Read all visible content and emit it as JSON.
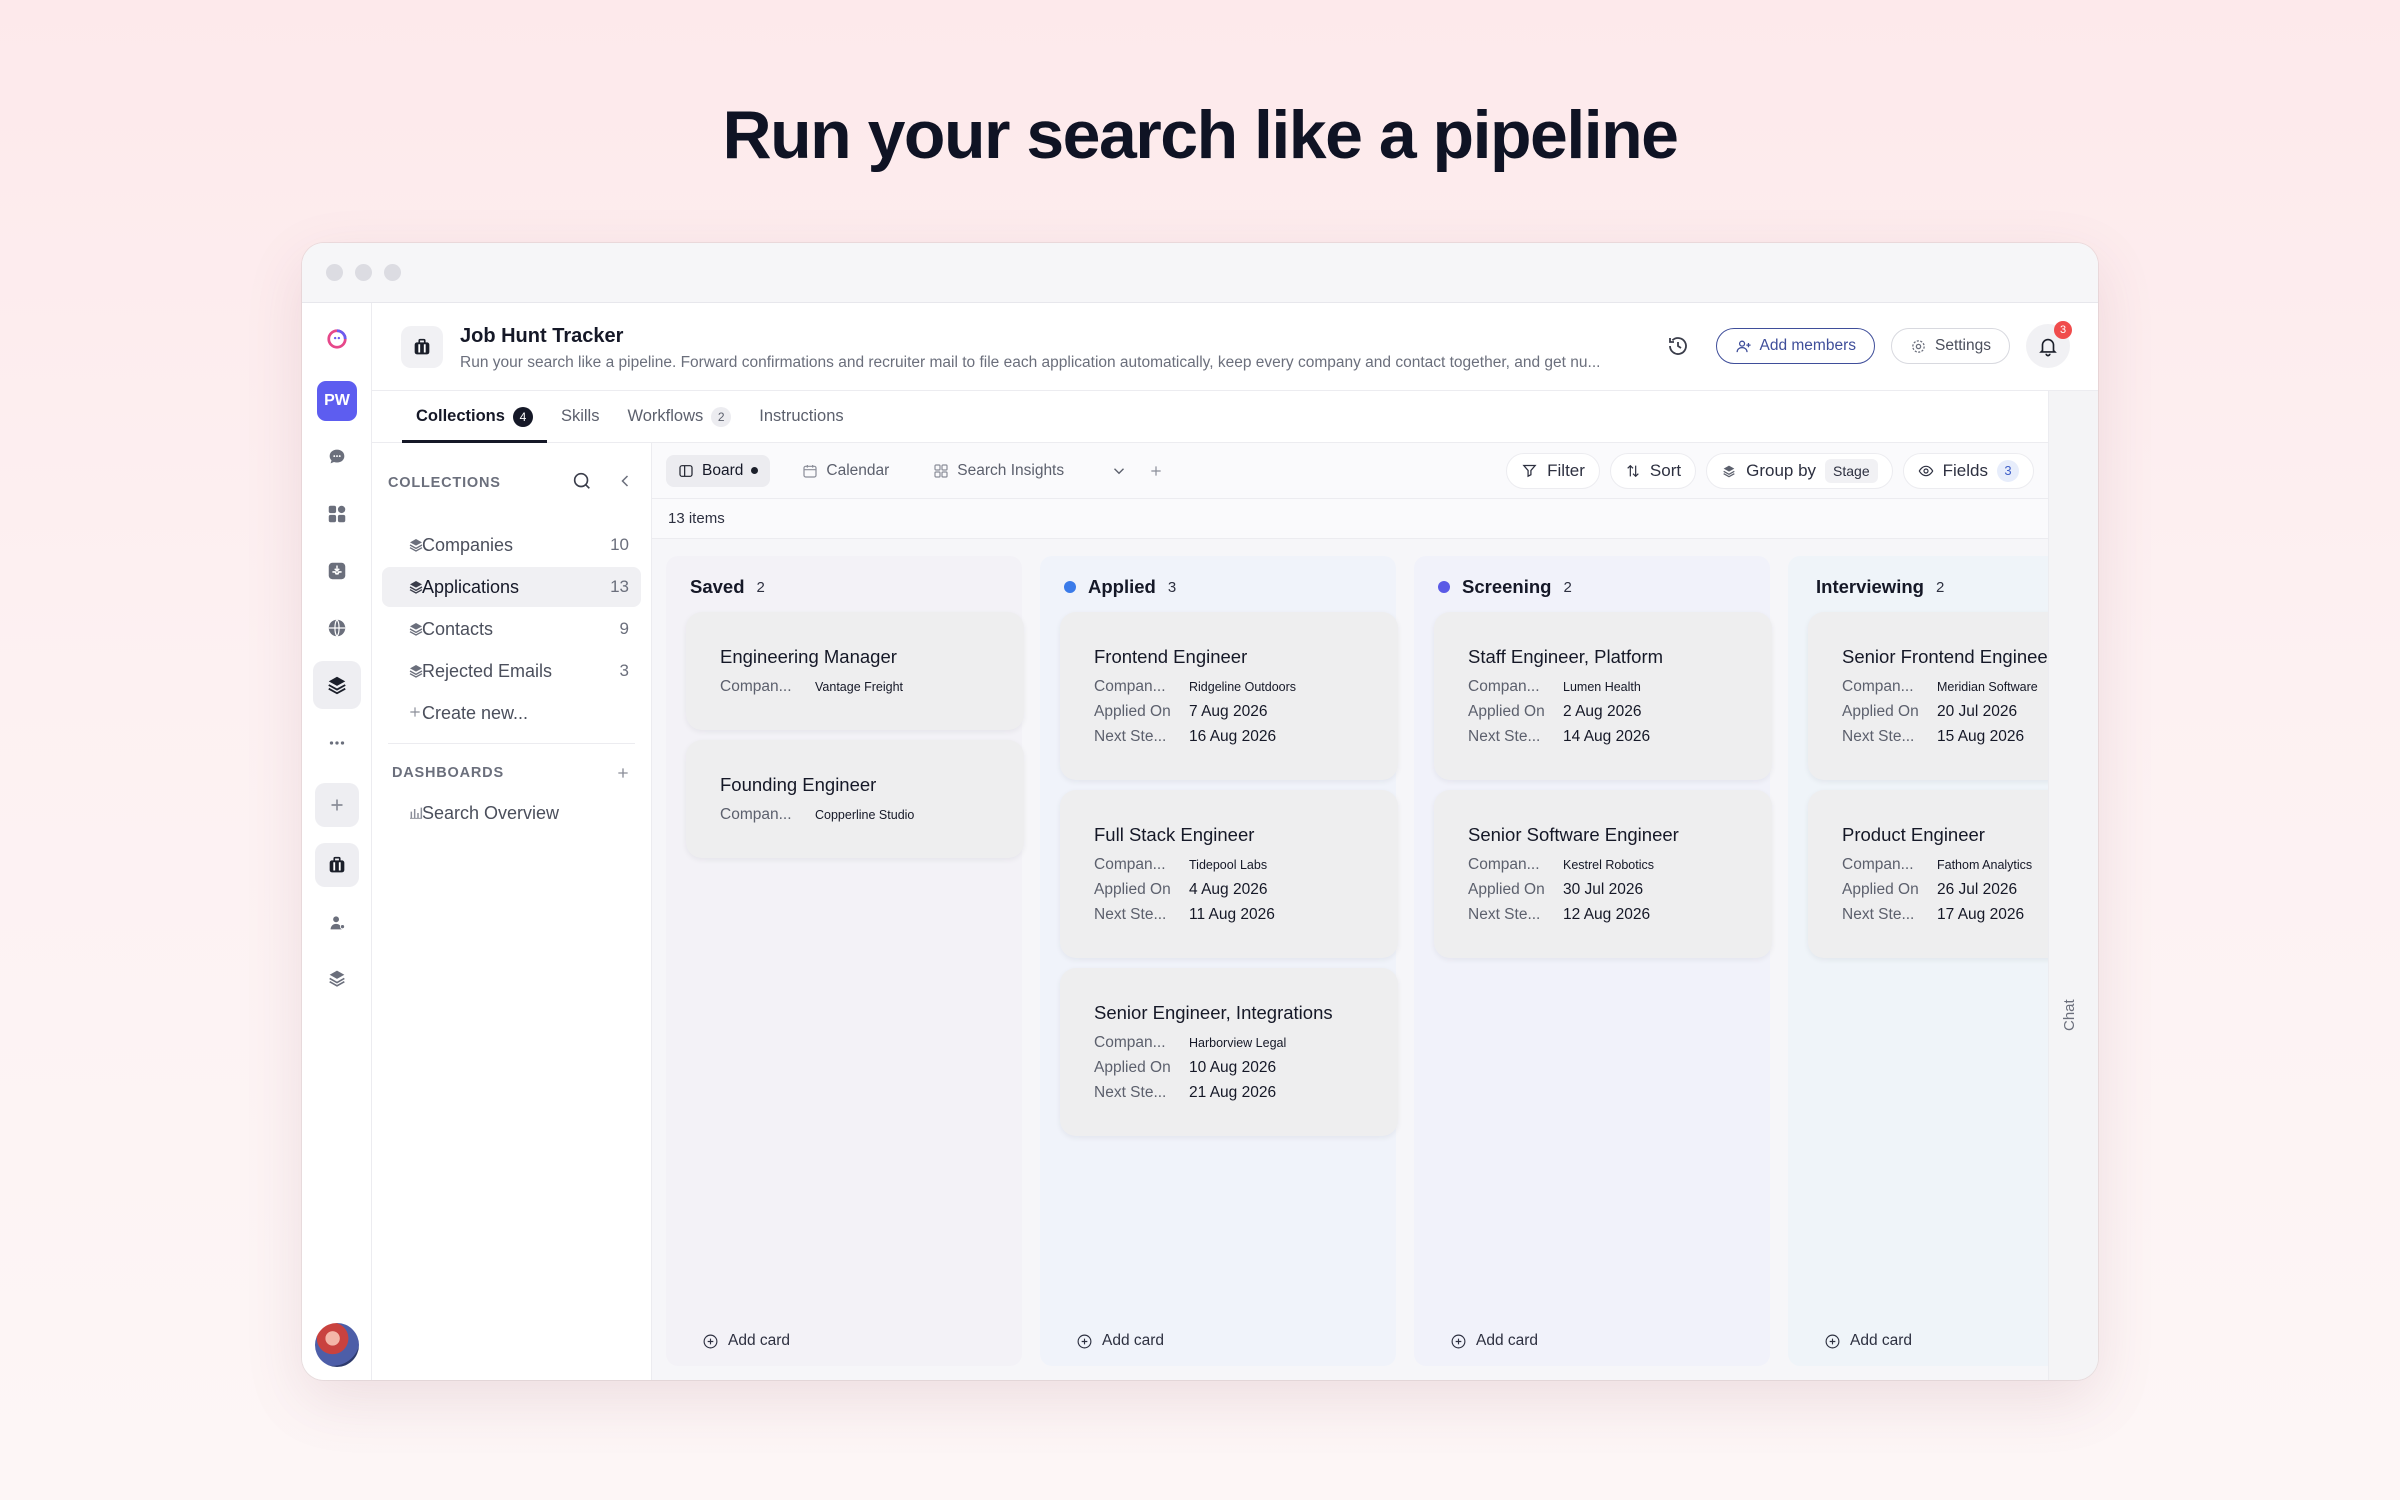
{
  "hero": {
    "title": "Run your search like a pipeline"
  },
  "rail": {
    "workspace_initials": "PW"
  },
  "header": {
    "title": "Job Hunt Tracker",
    "description": "Run your search like a pipeline. Forward confirmations and recruiter mail to file each application automatically, keep every company and contact together, and get nu...",
    "add_members_label": "Add members",
    "settings_label": "Settings",
    "notification_count": "3"
  },
  "tabs": [
    {
      "label": "Collections",
      "count": "4"
    },
    {
      "label": "Skills",
      "count": ""
    },
    {
      "label": "Workflows",
      "count": "2"
    },
    {
      "label": "Instructions",
      "count": ""
    }
  ],
  "chat_label": "Chat",
  "sidebar": {
    "collections_heading": "COLLECTIONS",
    "collections": [
      {
        "label": "Companies",
        "count": "10"
      },
      {
        "label": "Applications",
        "count": "13"
      },
      {
        "label": "Contacts",
        "count": "9"
      },
      {
        "label": "Rejected Emails",
        "count": "3"
      }
    ],
    "create_new": "Create new...",
    "dashboards_heading": "DASHBOARDS",
    "dashboards": [
      {
        "label": "Search Overview"
      }
    ]
  },
  "toolbar": {
    "views": [
      {
        "label": "Board"
      },
      {
        "label": "Calendar"
      },
      {
        "label": "Search Insights"
      }
    ],
    "filter_label": "Filter",
    "sort_label": "Sort",
    "group_by_label": "Group by",
    "group_by_value": "Stage",
    "fields_label": "Fields",
    "fields_count": "3"
  },
  "items_count": "13 items",
  "add_card_label": "Add card",
  "field_labels": {
    "company": "Compan...",
    "applied_on": "Applied On",
    "next_step": "Next Ste..."
  },
  "columns": [
    {
      "name": "Saved",
      "count": "2",
      "dot_color": "",
      "cards": [
        {
          "title": "Engineering Manager",
          "company": "Vantage Freight",
          "applied_on": "",
          "next_step": ""
        },
        {
          "title": "Founding Engineer",
          "company": "Copperline Studio",
          "applied_on": "",
          "next_step": ""
        }
      ]
    },
    {
      "name": "Applied",
      "count": "3",
      "dot_color": "#3b7be9",
      "cards": [
        {
          "title": "Frontend Engineer",
          "company": "Ridgeline Outdoors",
          "applied_on": "7 Aug 2026",
          "next_step": "16 Aug 2026"
        },
        {
          "title": "Full Stack Engineer",
          "company": "Tidepool Labs",
          "applied_on": "4 Aug 2026",
          "next_step": "11 Aug 2026"
        },
        {
          "title": "Senior Engineer, Integrations",
          "company": "Harborview Legal",
          "applied_on": "10 Aug 2026",
          "next_step": "21 Aug 2026"
        }
      ]
    },
    {
      "name": "Screening",
      "count": "2",
      "dot_color": "#5a5ae6",
      "cards": [
        {
          "title": "Staff Engineer, Platform",
          "company": "Lumen Health",
          "applied_on": "2 Aug 2026",
          "next_step": "14 Aug 2026"
        },
        {
          "title": "Senior Software Engineer",
          "company": "Kestrel Robotics",
          "applied_on": "30 Jul 2026",
          "next_step": "12 Aug 2026"
        }
      ]
    },
    {
      "name": "Interviewing",
      "count": "2",
      "dot_color": "",
      "cards": [
        {
          "title": "Senior Frontend Engineer",
          "company": "Meridian Software",
          "applied_on": "20 Jul 2026",
          "next_step": "15 Aug 2026"
        },
        {
          "title": "Product Engineer",
          "company": "Fathom Analytics",
          "applied_on": "26 Jul 2026",
          "next_step": "17 Aug 2026"
        }
      ]
    }
  ]
}
